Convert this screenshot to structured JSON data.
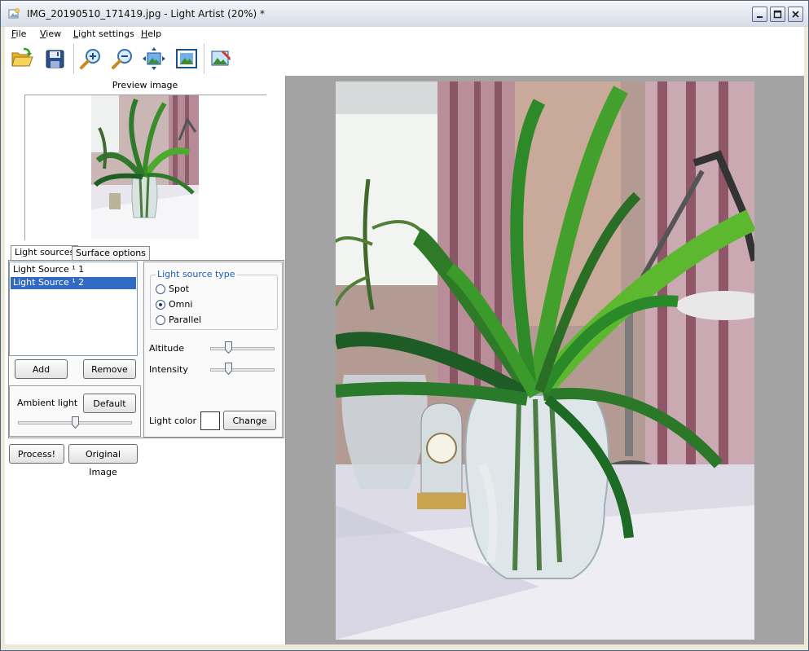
{
  "window": {
    "title": "IMG_20190510_171419.jpg - Light Artist (20%) *"
  },
  "menu": {
    "items": [
      "File",
      "View",
      "Light settings",
      "Help"
    ]
  },
  "toolbar": {
    "buttons": [
      "open-folder-icon",
      "save-disk-icon",
      "zoom-in-icon",
      "zoom-out-icon",
      "fit-to-window-icon",
      "actual-size-icon",
      "edit-image-icon"
    ]
  },
  "preview": {
    "title": "Preview image"
  },
  "tabs": {
    "light_sources": "Light sources",
    "surface_options": "Surface options"
  },
  "light_sources": {
    "items": [
      "Light Source ¹ 1",
      "Light Source ¹ 2"
    ],
    "selected_index": 1,
    "add_label": "Add",
    "remove_label": "Remove"
  },
  "ambient": {
    "label": "Ambient light",
    "default_label": "Default",
    "value": 0.5
  },
  "light_source_type": {
    "group_label": "Light source type",
    "options": [
      "Spot",
      "Omni",
      "Parallel"
    ],
    "selected": "Omni"
  },
  "altitude": {
    "label": "Altitude",
    "value": 0.25
  },
  "intensity": {
    "label": "Intensity",
    "value": 0.25
  },
  "light_color": {
    "label": "Light color",
    "change_label": "Change",
    "color": "#ffffff"
  },
  "actions": {
    "process_label": "Process!",
    "original_label": "Original Image"
  }
}
